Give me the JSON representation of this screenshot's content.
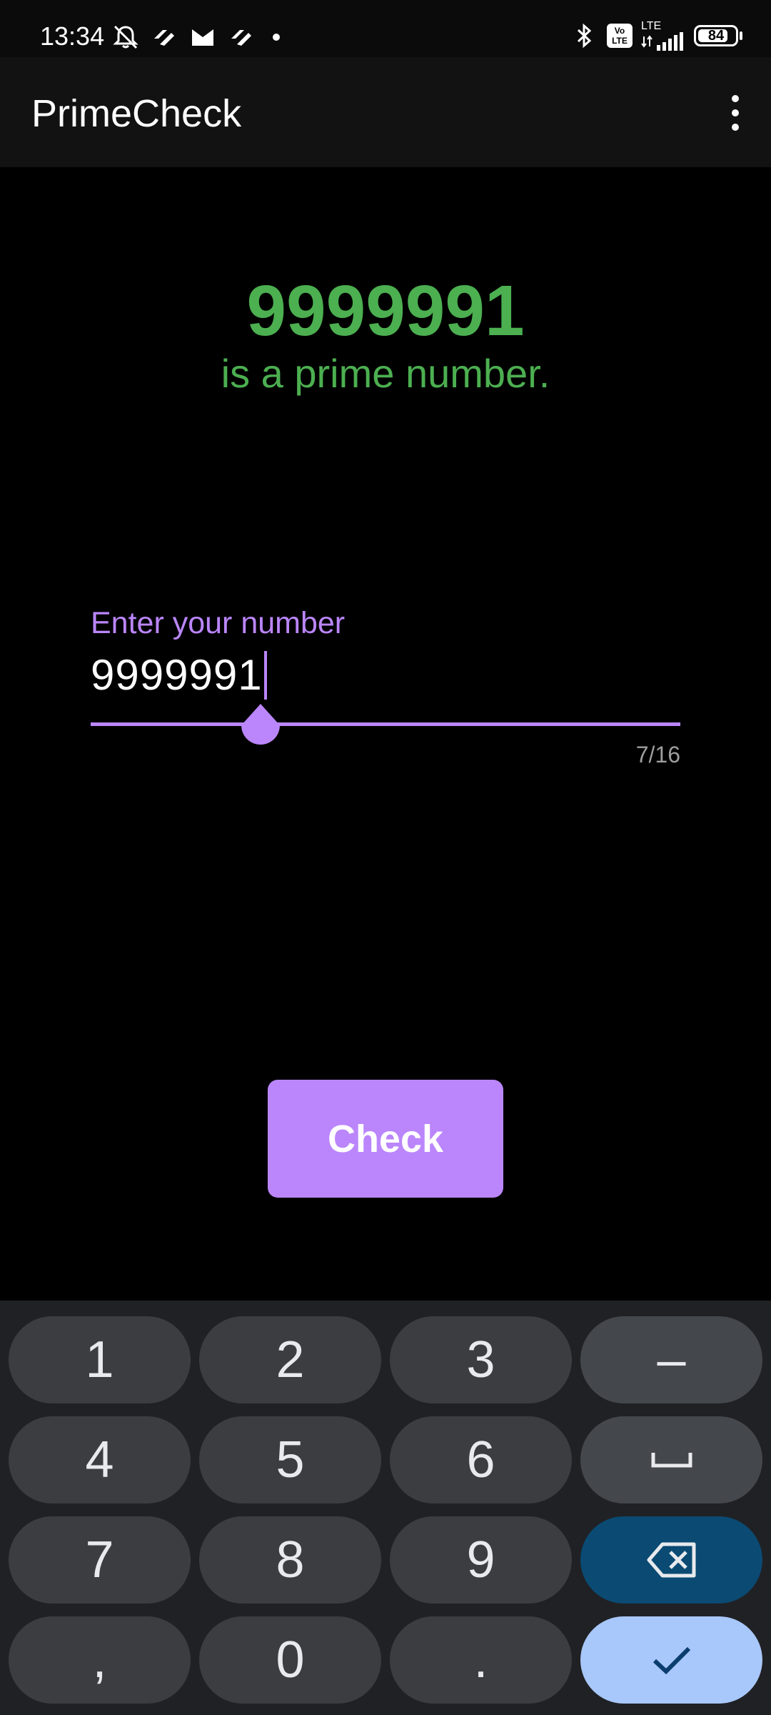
{
  "status_bar": {
    "time": "13:34",
    "lte_label": "LTE",
    "volte_label_top": "Vo",
    "volte_label_bottom": "LTE",
    "battery_level": "84",
    "battery_fraction": 0.84
  },
  "app_bar": {
    "title": "PrimeCheck",
    "overflow_icon": "more-vert-icon"
  },
  "result": {
    "number": "9999991",
    "message": "is a prime number.",
    "color": "#4caf50"
  },
  "input": {
    "label": "Enter your number",
    "value": "9999991",
    "counter": "7/16",
    "accent_color": "#bb86fc"
  },
  "check_button": {
    "label": "Check",
    "color": "#bb86fc"
  },
  "keyboard": {
    "rows": [
      [
        "1",
        "2",
        "3",
        "–"
      ],
      [
        "4",
        "5",
        "6",
        "space"
      ],
      [
        "7",
        "8",
        "9",
        "backspace"
      ],
      [
        ",",
        "0",
        ".",
        "done"
      ]
    ],
    "keys": {
      "k1": "1",
      "k2": "2",
      "k3": "3",
      "dash": "–",
      "k4": "4",
      "k5": "5",
      "k6": "6",
      "k7": "7",
      "k8": "8",
      "k9": "9",
      "comma": ",",
      "k0": "0",
      "period": "."
    }
  }
}
